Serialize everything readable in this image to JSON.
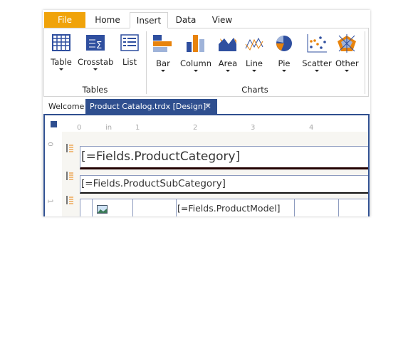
{
  "tabs": [
    {
      "label": "File",
      "active": false
    },
    {
      "label": "Home"
    },
    {
      "label": "Insert",
      "active": true
    },
    {
      "label": "Data"
    },
    {
      "label": "View"
    }
  ],
  "colors": {
    "file_tab": "#f0a30a",
    "accent_blue": "#2f4f8f",
    "orange": "#e8830c"
  },
  "groups": {
    "tables": {
      "label": "Tables",
      "items": [
        {
          "label": "Table",
          "icon": "table-icon",
          "dropdown": true
        },
        {
          "label": "Crosstab",
          "icon": "crosstab-icon",
          "dropdown": true
        },
        {
          "label": "List",
          "icon": "list-icon",
          "dropdown": false
        }
      ]
    },
    "charts": {
      "label": "Charts",
      "items": [
        {
          "label": "Bar",
          "icon": "bar-chart-icon"
        },
        {
          "label": "Column",
          "icon": "column-chart-icon"
        },
        {
          "label": "Area",
          "icon": "area-chart-icon"
        },
        {
          "label": "Line",
          "icon": "line-chart-icon"
        },
        {
          "label": "Pie",
          "icon": "pie-chart-icon"
        },
        {
          "label": "Scatter",
          "icon": "scatter-chart-icon"
        },
        {
          "label": "Other",
          "icon": "radar-chart-icon"
        }
      ]
    }
  },
  "doc_tabs": {
    "welcome": "Welcome",
    "active": "Product Catalog.trdx [Design]*",
    "close": "✕"
  },
  "ruler": {
    "unit": "in",
    "marks": [
      "0",
      "1",
      "2",
      "3",
      "4"
    ],
    "vmarks": [
      "0",
      "1"
    ]
  },
  "fields": {
    "category": "[=Fields.ProductCategory]",
    "subcategory": "[=Fields.ProductSubCategory]",
    "model": "[=Fields.ProductModel]"
  }
}
